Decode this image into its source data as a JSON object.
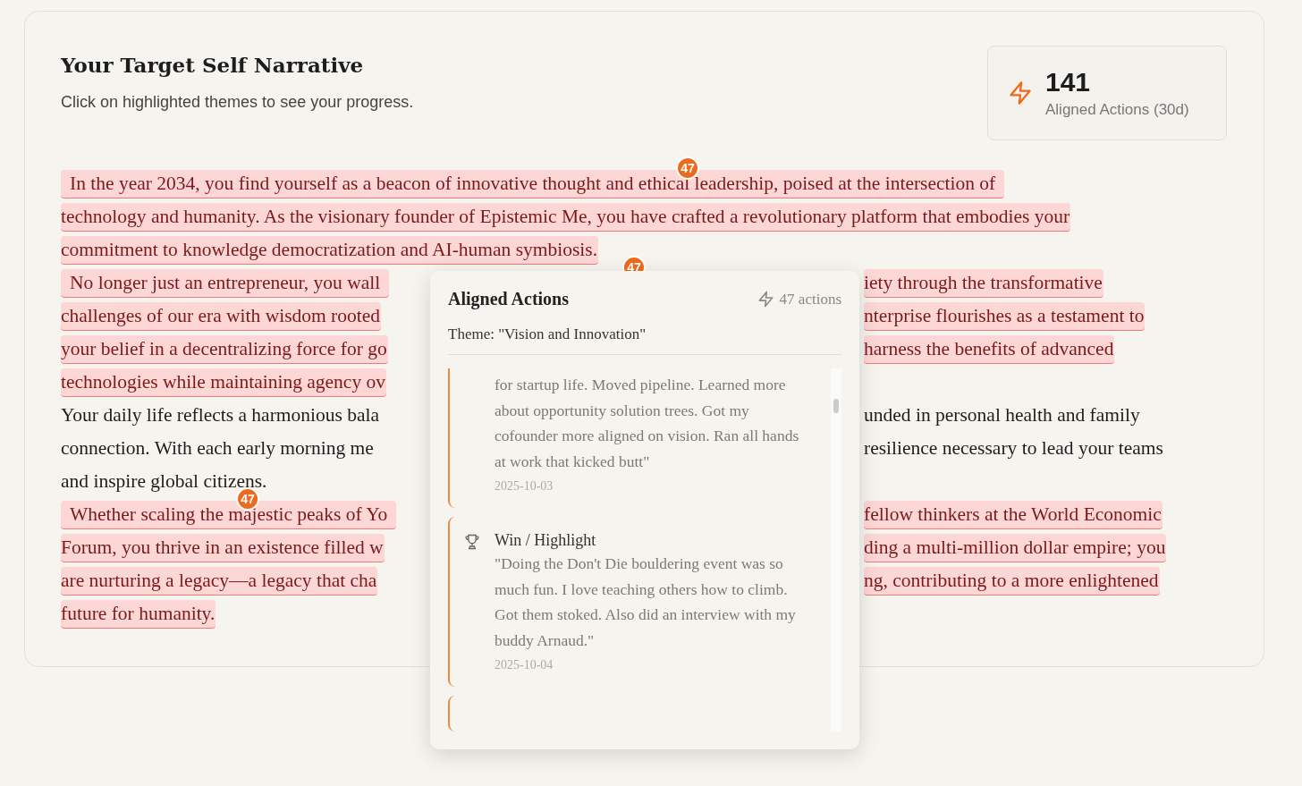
{
  "header": {
    "title": "Your Target Self Narrative",
    "subtitle": "Click on highlighted themes to see your progress."
  },
  "stat": {
    "value": "141",
    "label": "Aligned Actions (30d)"
  },
  "paragraphs": [
    {
      "highlighted": true,
      "badge": "47",
      "lines": [
        {
          "text": "In the year 2034, you find yourself as a beacon of innovative thought and ethical leadership, poised at the intersection of"
        },
        {
          "text": "technology and humanity. As the visionary founder of Epistemic Me, you have crafted a revolutionary platform that embodies your"
        },
        {
          "text": "commitment to knowledge democratization and AI-human symbiosis."
        }
      ]
    },
    {
      "highlighted": true,
      "badge": "47",
      "lines": [
        {
          "left": "No longer just an entrepreneur, you wall",
          "right": "iety through the transformative"
        },
        {
          "left": "challenges of our era with wisdom rooted",
          "right": "nterprise flourishes as a testament to"
        },
        {
          "left": "your belief in a decentralizing force for go",
          "right": "harness the benefits of advanced"
        },
        {
          "left": "technologies while maintaining agency ov"
        }
      ]
    },
    {
      "highlighted": false,
      "lines": [
        {
          "left": "Your daily life reflects a harmonious bala",
          "right": "unded in personal health and family"
        },
        {
          "left": "connection. With each early morning me",
          "right": "resilience necessary to lead your teams"
        },
        {
          "text": "and inspire global citizens."
        }
      ]
    },
    {
      "highlighted": true,
      "badge": "47",
      "lines": [
        {
          "left": "Whether scaling the majestic peaks of Yo",
          "right": "fellow thinkers at the World Economic"
        },
        {
          "left": "Forum, you thrive in an existence filled w",
          "right": "ding a multi-million dollar empire; you"
        },
        {
          "left": "are nurturing a legacy—a legacy that cha",
          "right": "ng, contributing to a more enlightened"
        },
        {
          "text": "future for humanity."
        }
      ]
    }
  ],
  "popover": {
    "title": "Aligned Actions",
    "count": "47 actions",
    "theme": "Theme: \"Vision and Innovation\"",
    "entries": [
      {
        "kind": "continued",
        "text": "for startup life. Moved pipeline. Learned more about opportunity solution trees. Got my cofounder more aligned on vision. Ran all hands at work that kicked butt\"",
        "date": "2025-10-03"
      },
      {
        "kind": "win",
        "heading": "Win / Highlight",
        "text": "\"Doing the Don't Die bouldering event was so much fun. I love teaching others how to climb. Got them stoked. Also did an interview with my buddy Arnaud.\"",
        "date": "2025-10-04"
      },
      {
        "kind": "partial"
      }
    ]
  }
}
